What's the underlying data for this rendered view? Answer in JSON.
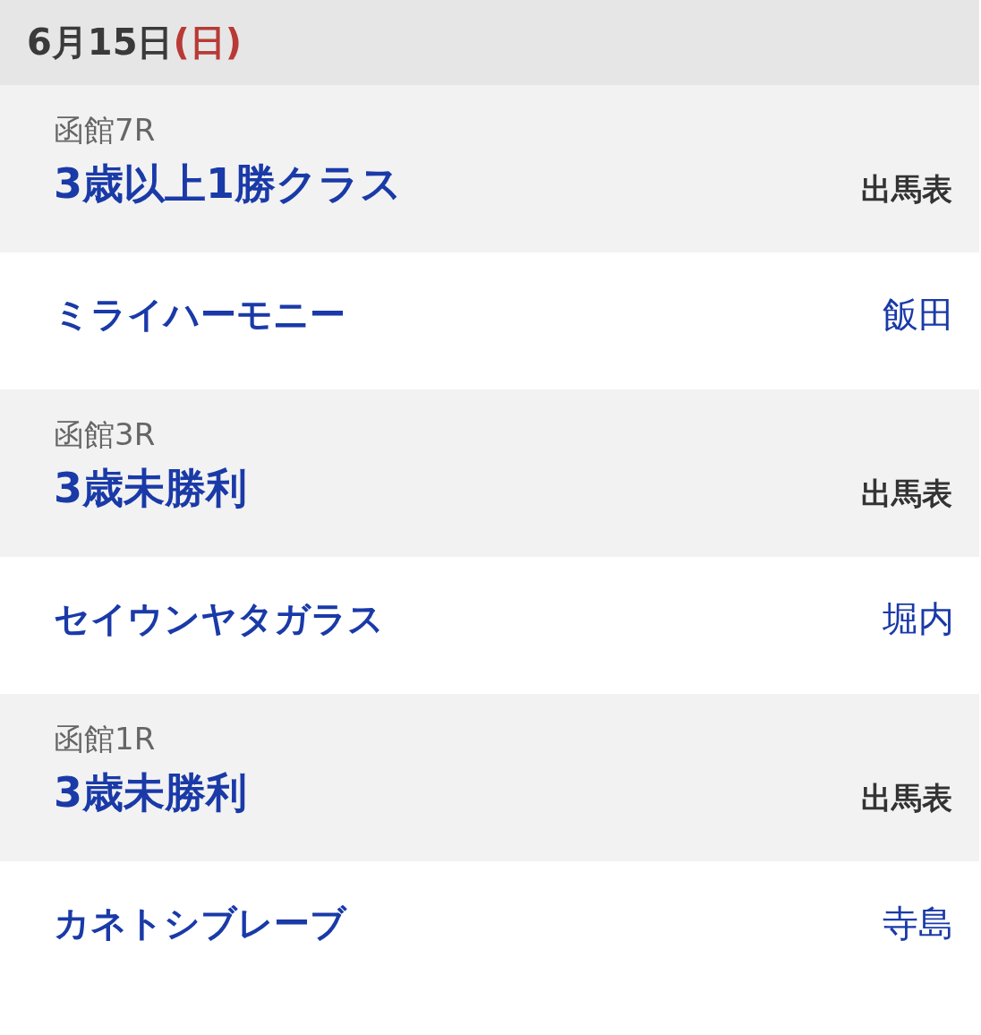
{
  "date_header": {
    "date": "6月15日",
    "weekday": {
      "text": "(日)",
      "kind": "sunday"
    }
  },
  "races": [
    {
      "venue_race": "函館7R",
      "race_name": "3歳以上1勝クラス",
      "entry_link": "出馬表",
      "horse": "ミライハーモニー",
      "jockey": "飯田"
    },
    {
      "venue_race": "函館3R",
      "race_name": "3歳未勝利",
      "entry_link": "出馬表",
      "horse": "セイウンヤタガラス",
      "jockey": "堀内"
    },
    {
      "venue_race": "函館1R",
      "race_name": "3歳未勝利",
      "entry_link": "出馬表",
      "horse": "カネトシブレーブ",
      "jockey": "寺島"
    }
  ]
}
